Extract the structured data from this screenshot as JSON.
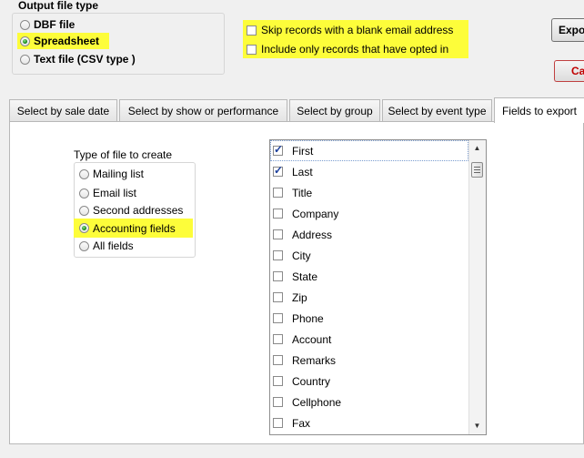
{
  "output_group": {
    "title": "Output file type",
    "options": [
      {
        "label": "DBF file",
        "selected": false
      },
      {
        "label": "Spreadsheet",
        "selected": true
      },
      {
        "label": "Text file (CSV type )",
        "selected": false
      }
    ]
  },
  "filters": {
    "skip_blank_email": {
      "label": "Skip records with a blank email address",
      "checked": false
    },
    "opted_in_only": {
      "label": "Include only records that have opted in",
      "checked": false
    }
  },
  "buttons": {
    "export_label": "Expo",
    "cancel_label": "Ca"
  },
  "tabs": [
    {
      "label": "Select by sale date",
      "active": false
    },
    {
      "label": "Select by show or performance",
      "active": false
    },
    {
      "label": "Select by group",
      "active": false
    },
    {
      "label": "Select by event type",
      "active": false
    },
    {
      "label": "Fields to export",
      "active": true
    }
  ],
  "file_type": {
    "title": "Type of file to create",
    "options": [
      {
        "label": "Mailing list",
        "selected": false
      },
      {
        "label": "Email list",
        "selected": false
      },
      {
        "label": "Second addresses",
        "selected": false
      },
      {
        "label": "Accounting fields",
        "selected": true
      },
      {
        "label": "All fields",
        "selected": false
      }
    ]
  },
  "fields": [
    {
      "label": "First",
      "checked": true
    },
    {
      "label": "Last",
      "checked": true
    },
    {
      "label": "Title",
      "checked": false
    },
    {
      "label": "Company",
      "checked": false
    },
    {
      "label": "Address",
      "checked": false
    },
    {
      "label": "City",
      "checked": false
    },
    {
      "label": "State",
      "checked": false
    },
    {
      "label": "Zip",
      "checked": false
    },
    {
      "label": "Phone",
      "checked": false
    },
    {
      "label": "Account",
      "checked": false
    },
    {
      "label": "Remarks",
      "checked": false
    },
    {
      "label": "Country",
      "checked": false
    },
    {
      "label": "Cellphone",
      "checked": false
    },
    {
      "label": "Fax",
      "checked": false
    }
  ],
  "colors": {
    "highlight": "#fdfd3a",
    "radio_selected": "#0a7d0a",
    "check_mark": "#1c3f9c"
  }
}
